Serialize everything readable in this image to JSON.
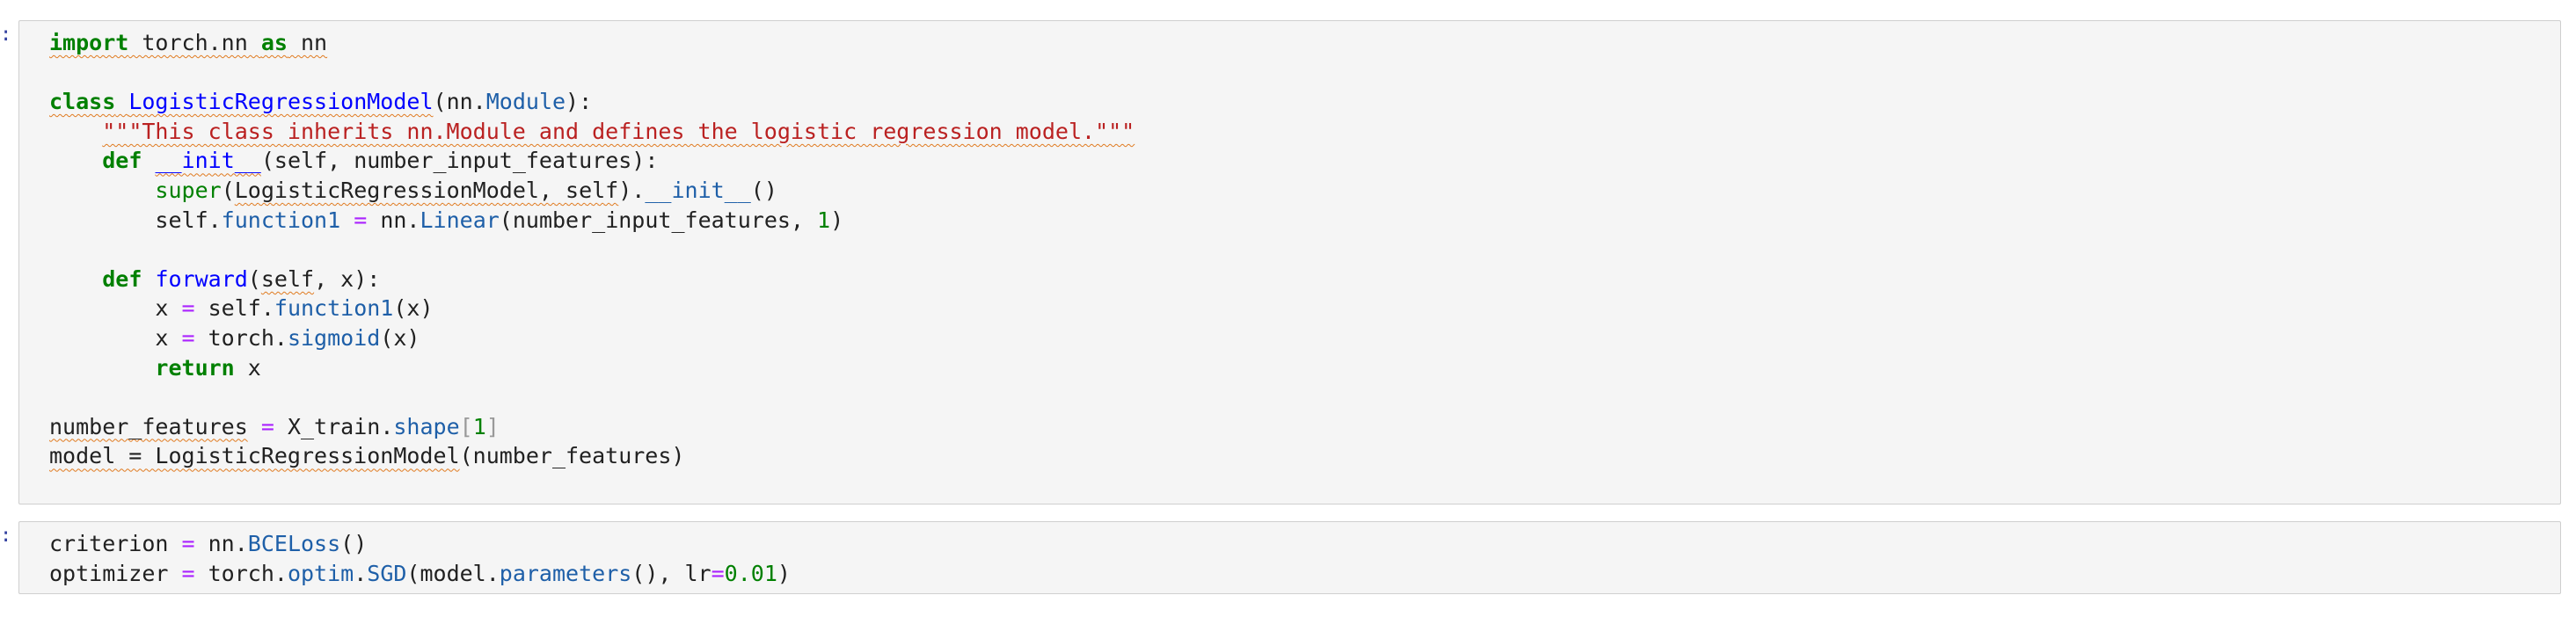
{
  "cells": [
    {
      "prompt": ":",
      "lines": [
        [
          {
            "text": "import",
            "cls": "kw sq"
          },
          {
            "text": " torch.nn ",
            "cls": "sq"
          },
          {
            "text": "as",
            "cls": "kw sq"
          },
          {
            "text": " nn",
            "cls": "sq"
          }
        ],
        [],
        [
          {
            "text": "class",
            "cls": "kw sq"
          },
          {
            "text": " ",
            "cls": "sq"
          },
          {
            "text": "LogisticRegressionModel",
            "cls": "cls sq"
          },
          {
            "text": "(nn.",
            "cls": ""
          },
          {
            "text": "Module",
            "cls": "attr"
          },
          {
            "text": "):",
            "cls": ""
          }
        ],
        [
          {
            "text": "    ",
            "cls": ""
          },
          {
            "text": "\"\"\"This class inherits nn.Module and defines the logistic regression model.\"\"\"",
            "cls": "str sq"
          }
        ],
        [
          {
            "text": "    ",
            "cls": ""
          },
          {
            "text": "def",
            "cls": "kw"
          },
          {
            "text": " ",
            "cls": ""
          },
          {
            "text": "__init__",
            "cls": "fn sq"
          },
          {
            "text": "(self, number_input_features):",
            "cls": ""
          }
        ],
        [
          {
            "text": "        ",
            "cls": ""
          },
          {
            "text": "super",
            "cls": "builtin"
          },
          {
            "text": "(",
            "cls": ""
          },
          {
            "text": "LogisticRegressionModel, self",
            "cls": "sq"
          },
          {
            "text": ").",
            "cls": ""
          },
          {
            "text": "__init__",
            "cls": "attr"
          },
          {
            "text": "()",
            "cls": ""
          }
        ],
        [
          {
            "text": "        self.",
            "cls": ""
          },
          {
            "text": "function1",
            "cls": "attr"
          },
          {
            "text": " ",
            "cls": ""
          },
          {
            "text": "=",
            "cls": "op"
          },
          {
            "text": " nn.",
            "cls": ""
          },
          {
            "text": "Linear",
            "cls": "attr"
          },
          {
            "text": "(number_input_features, ",
            "cls": ""
          },
          {
            "text": "1",
            "cls": "num"
          },
          {
            "text": ")",
            "cls": ""
          }
        ],
        [],
        [
          {
            "text": "    ",
            "cls": ""
          },
          {
            "text": "def",
            "cls": "kw"
          },
          {
            "text": " ",
            "cls": ""
          },
          {
            "text": "forward",
            "cls": "fn"
          },
          {
            "text": "(",
            "cls": ""
          },
          {
            "text": "self",
            "cls": "sq"
          },
          {
            "text": ", x):",
            "cls": ""
          }
        ],
        [
          {
            "text": "        x ",
            "cls": ""
          },
          {
            "text": "=",
            "cls": "op"
          },
          {
            "text": " self.",
            "cls": ""
          },
          {
            "text": "function1",
            "cls": "attr"
          },
          {
            "text": "(x)",
            "cls": ""
          }
        ],
        [
          {
            "text": "        x ",
            "cls": ""
          },
          {
            "text": "=",
            "cls": "op"
          },
          {
            "text": " torch.",
            "cls": ""
          },
          {
            "text": "sigmoid",
            "cls": "attr"
          },
          {
            "text": "(x)",
            "cls": ""
          }
        ],
        [
          {
            "text": "        ",
            "cls": ""
          },
          {
            "text": "return",
            "cls": "kw"
          },
          {
            "text": " x",
            "cls": ""
          }
        ],
        [],
        [
          {
            "text": "number_features",
            "cls": "sq"
          },
          {
            "text": " ",
            "cls": ""
          },
          {
            "text": "=",
            "cls": "op"
          },
          {
            "text": " X_train.",
            "cls": ""
          },
          {
            "text": "shape",
            "cls": "attr"
          },
          {
            "text": "[",
            "cls": "bracket"
          },
          {
            "text": "1",
            "cls": "num"
          },
          {
            "text": "]",
            "cls": "bracket"
          }
        ],
        [
          {
            "text": "model = LogisticRegressionModel",
            "cls": "sq"
          },
          {
            "text": "(number_features)",
            "cls": ""
          }
        ]
      ]
    },
    {
      "prompt": ":",
      "lines": [
        [
          {
            "text": "criterion ",
            "cls": ""
          },
          {
            "text": "=",
            "cls": "op"
          },
          {
            "text": " nn.",
            "cls": ""
          },
          {
            "text": "BCELoss",
            "cls": "attr"
          },
          {
            "text": "()",
            "cls": ""
          }
        ],
        [
          {
            "text": "optimizer ",
            "cls": ""
          },
          {
            "text": "=",
            "cls": "op"
          },
          {
            "text": " torch.",
            "cls": ""
          },
          {
            "text": "optim",
            "cls": "attr"
          },
          {
            "text": ".",
            "cls": ""
          },
          {
            "text": "SGD",
            "cls": "attr"
          },
          {
            "text": "(model.",
            "cls": ""
          },
          {
            "text": "parameters",
            "cls": "attr"
          },
          {
            "text": "(), lr",
            "cls": ""
          },
          {
            "text": "=",
            "cls": "op"
          },
          {
            "text": "0.01",
            "cls": "num"
          },
          {
            "text": ")",
            "cls": ""
          }
        ]
      ]
    }
  ]
}
